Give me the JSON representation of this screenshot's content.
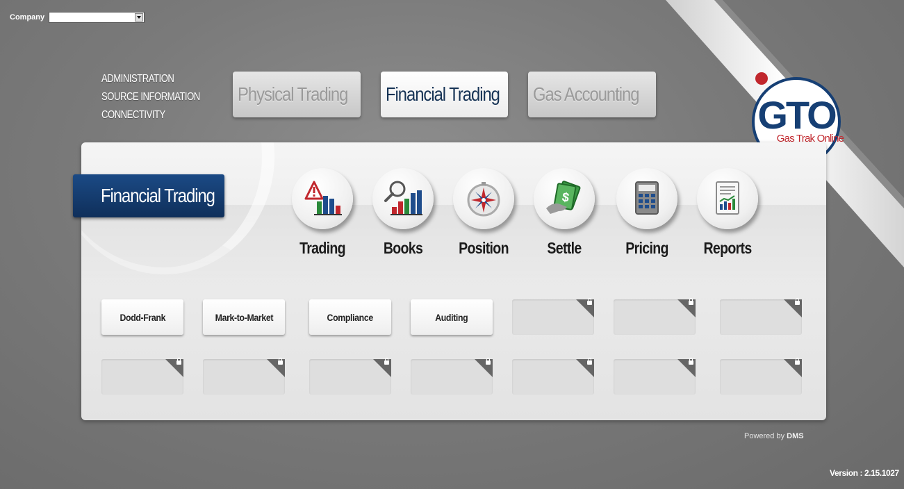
{
  "company": {
    "label": "Company",
    "selected": ""
  },
  "admin_links": [
    "ADMINISTRATION",
    "SOURCE INFORMATION",
    "CONNECTIVITY"
  ],
  "module_tabs": [
    {
      "label": "Physical Trading",
      "active": false
    },
    {
      "label": "Financial Trading",
      "active": true
    },
    {
      "label": "Gas Accounting",
      "active": false
    }
  ],
  "logo": {
    "mark": "GTO",
    "tagline": "Gas Trak Online"
  },
  "section": {
    "title": "Financial Trading"
  },
  "features": [
    {
      "label": "Trading",
      "icon": "trading-alert-chart-icon"
    },
    {
      "label": "Books",
      "icon": "books-magnifier-chart-icon"
    },
    {
      "label": "Position",
      "icon": "compass-icon"
    },
    {
      "label": "Settle",
      "icon": "money-hand-icon"
    },
    {
      "label": "Pricing",
      "icon": "calculator-icon"
    },
    {
      "label": "Reports",
      "icon": "report-chart-icon"
    }
  ],
  "tiles_row1": [
    {
      "label": "Dodd-Frank",
      "locked": false
    },
    {
      "label": "Mark-to-Market",
      "locked": false
    },
    {
      "label": "Compliance",
      "locked": false
    },
    {
      "label": "Auditing",
      "locked": false
    },
    {
      "label": "",
      "locked": true
    },
    {
      "label": "",
      "locked": true
    },
    {
      "label": "",
      "locked": true
    }
  ],
  "tiles_row2_locked_count": 7,
  "footer": {
    "powered_prefix": "Powered by",
    "powered_brand": "DMS",
    "version": "Version : 2.15.1027"
  },
  "colors": {
    "navy": "#163f74",
    "logo_red": "#c1272d",
    "bg_gray": "#7a7a7a"
  }
}
